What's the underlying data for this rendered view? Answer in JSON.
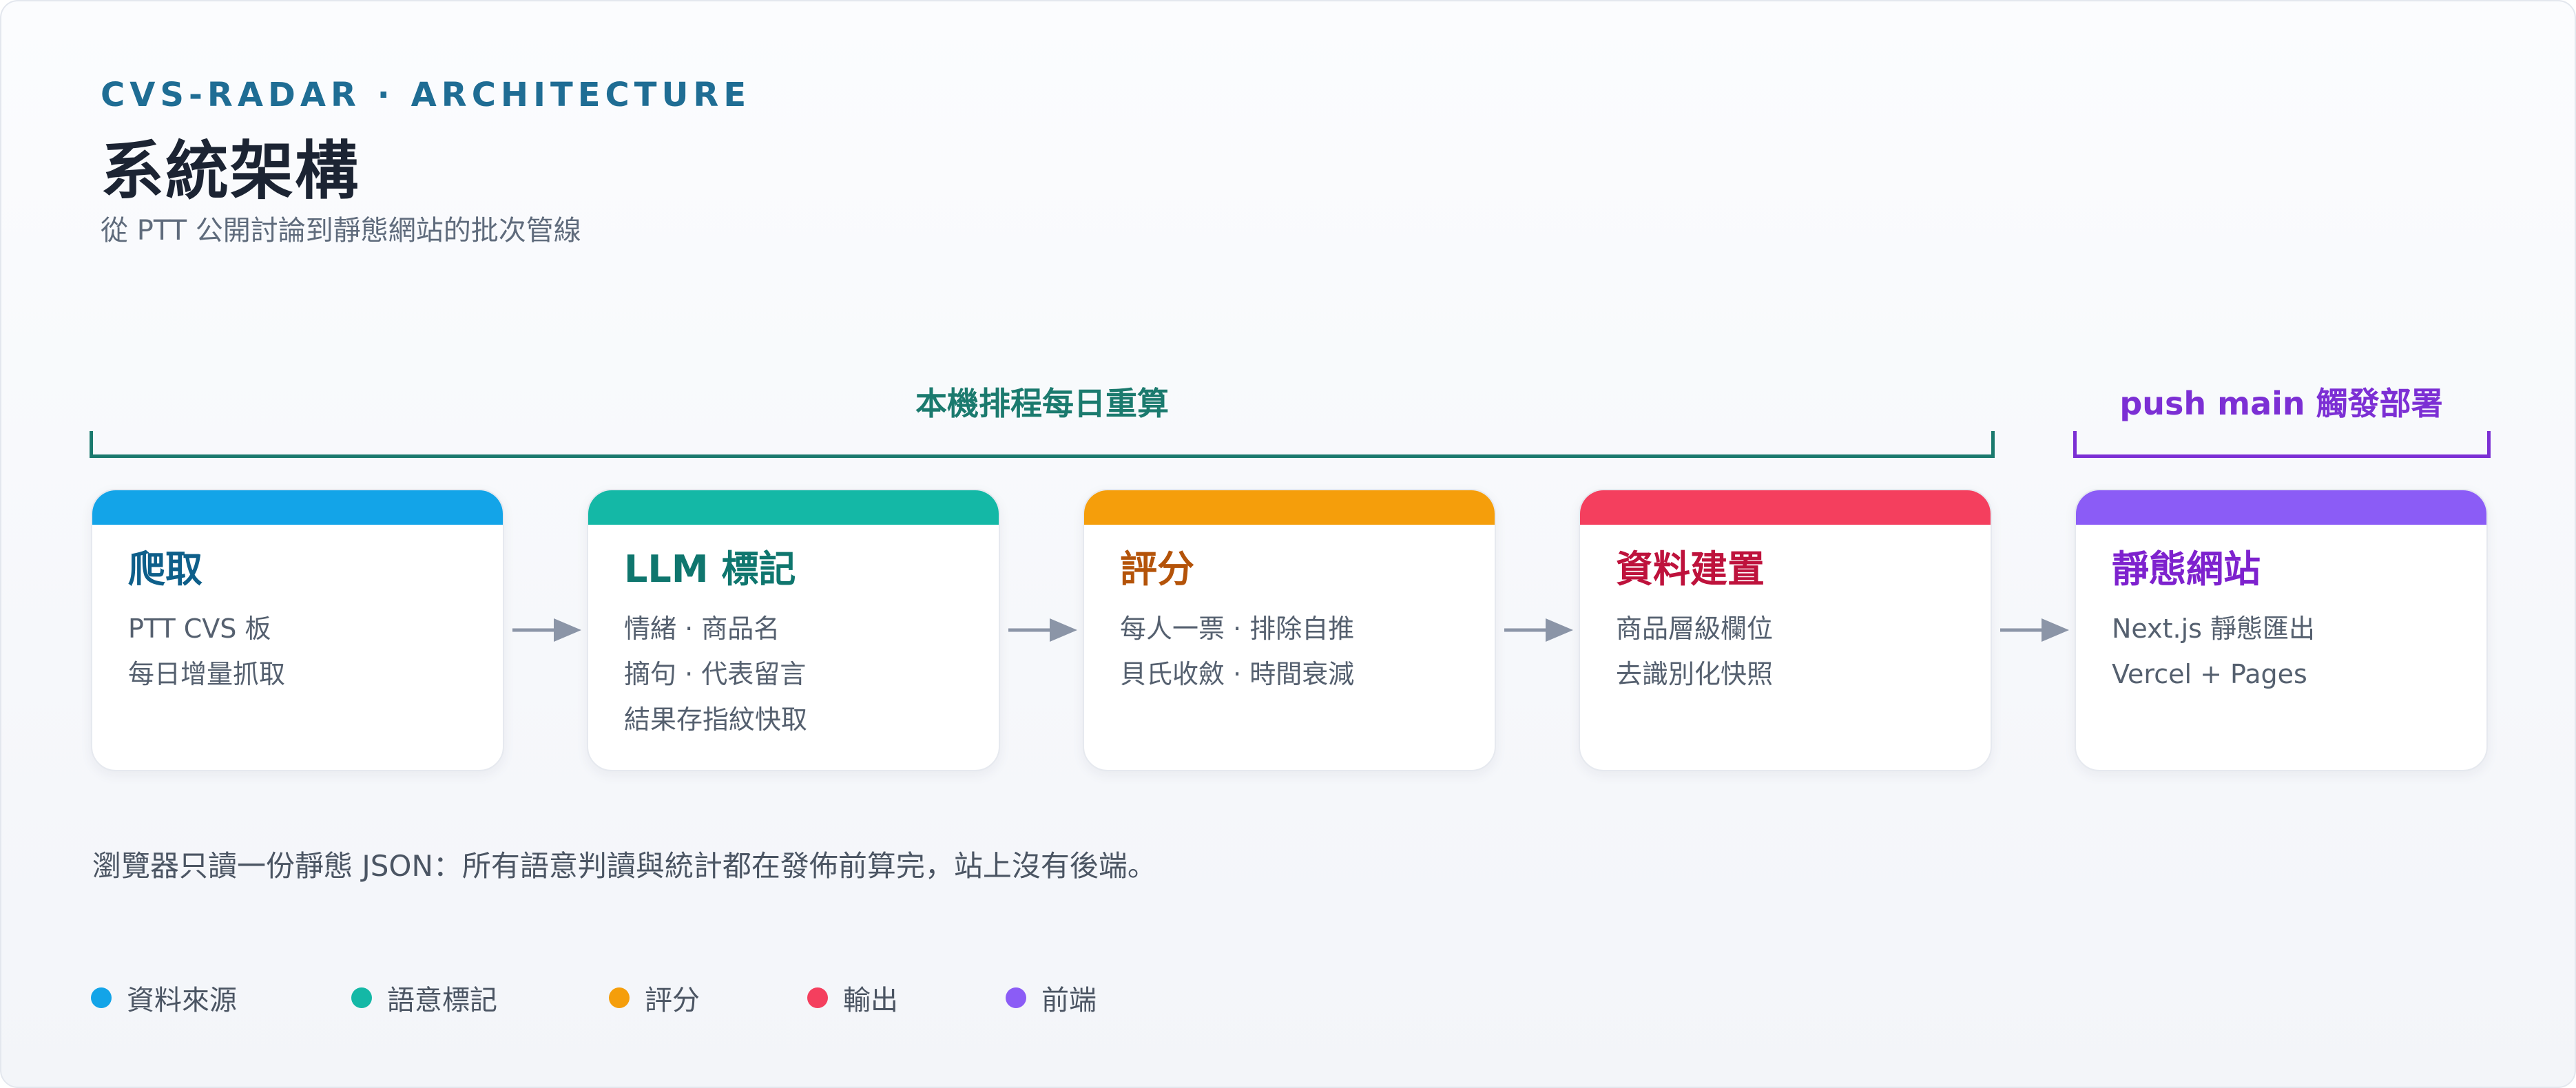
{
  "header": {
    "eyebrow": "CVS-RADAR · ARCHITECTURE",
    "title": "系統架構",
    "subtitle": "從 PTT 公開討論到靜態網站的批次管線"
  },
  "brackets": [
    {
      "label": "本機排程每日重算",
      "color": "#1b7a6e"
    },
    {
      "label": "push main 觸發部署",
      "color": "#7c2fd4"
    }
  ],
  "stages": [
    {
      "title": "爬取",
      "lines": [
        "PTT CVS 板",
        "每日增量抓取"
      ],
      "bar_color": "#13a4e8",
      "title_color": "#0e5f8a"
    },
    {
      "title": "LLM 標記",
      "lines": [
        "情緒 · 商品名",
        "摘句 · 代表留言",
        "結果存指紋快取"
      ],
      "bar_color": "#14b8a6",
      "title_color": "#0f766e"
    },
    {
      "title": "評分",
      "lines": [
        "每人一票 · 排除自推",
        "貝氏收斂 · 時間衰減"
      ],
      "bar_color": "#f59e0b",
      "title_color": "#b45309"
    },
    {
      "title": "資料建置",
      "lines": [
        "商品層級欄位",
        "去識別化快照"
      ],
      "bar_color": "#f43f5e",
      "title_color": "#be123c"
    },
    {
      "title": "靜態網站",
      "lines": [
        "Next.js 靜態匯出",
        "Vercel + Pages"
      ],
      "bar_color": "#8b5cf6",
      "title_color": "#7e22ce"
    }
  ],
  "arrow_color": "#8b95a7",
  "footnote": "瀏覽器只讀一份靜態 JSON：所有語意判讀與統計都在發佈前算完，站上沒有後端。",
  "legend": [
    {
      "label": "資料來源",
      "color": "#13a4e8"
    },
    {
      "label": "語意標記",
      "color": "#14b8a6"
    },
    {
      "label": "評分",
      "color": "#f59e0b"
    },
    {
      "label": "輸出",
      "color": "#f43f5e"
    },
    {
      "label": "前端",
      "color": "#8b5cf6"
    }
  ]
}
